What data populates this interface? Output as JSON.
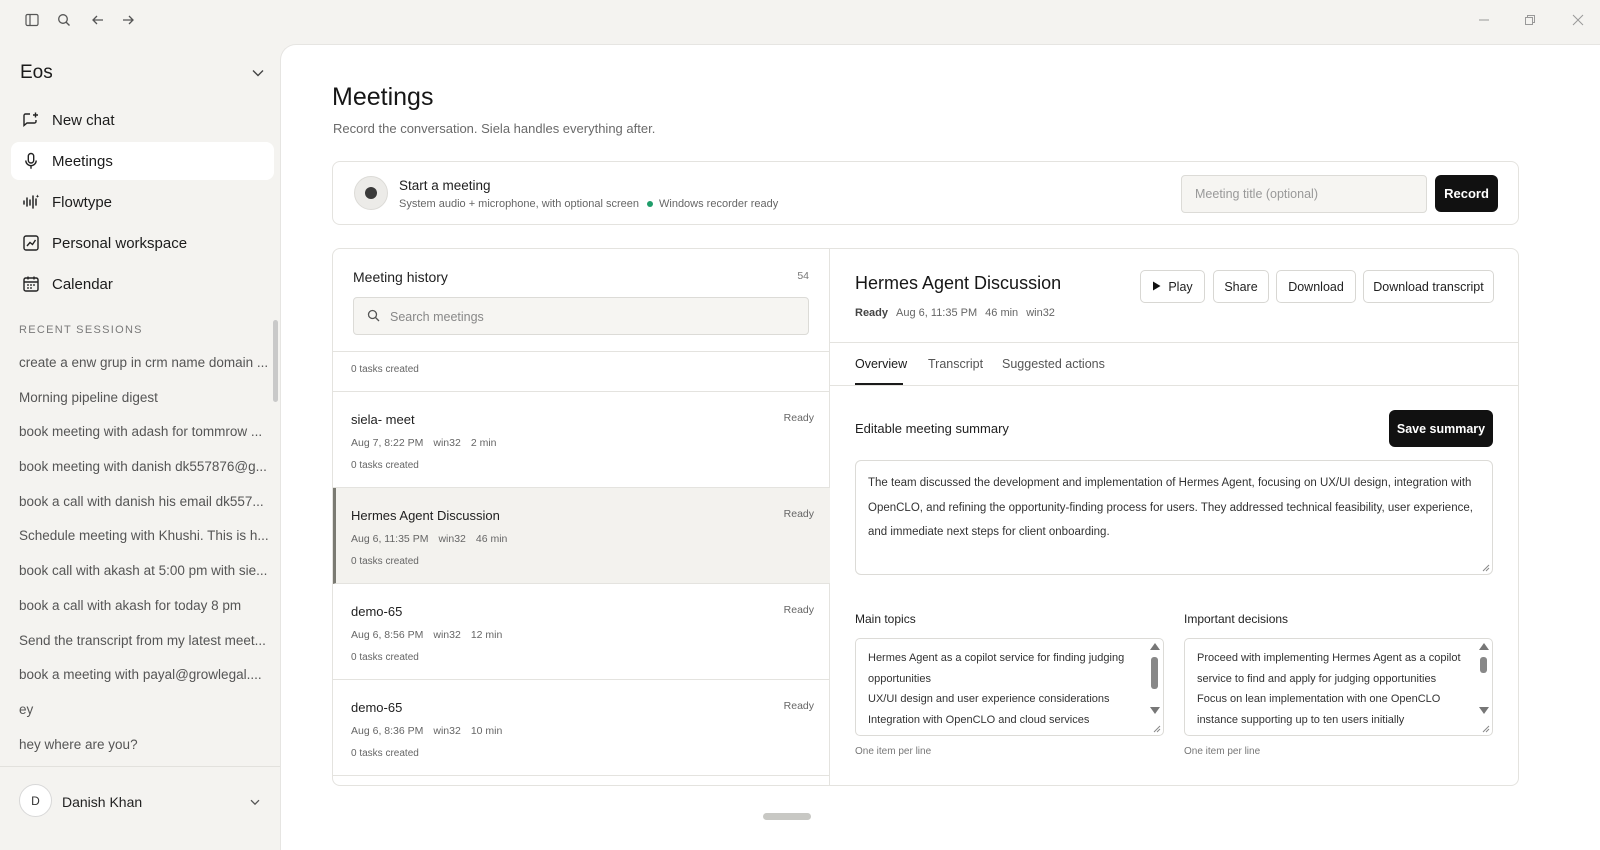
{
  "titlebar": {
    "icons": [
      "sidebar-toggle-icon",
      "search-icon",
      "arrow-left-icon",
      "arrow-right-icon"
    ]
  },
  "sidebar": {
    "workspace": "Eos",
    "nav": [
      {
        "label": "New chat",
        "icon": "new-chat-icon"
      },
      {
        "label": "Meetings",
        "icon": "microphone-icon",
        "active": true
      },
      {
        "label": "Flowtype",
        "icon": "waveform-icon"
      },
      {
        "label": "Personal workspace",
        "icon": "chart-icon"
      },
      {
        "label": "Calendar",
        "icon": "calendar-icon"
      }
    ],
    "recent_heading": "RECENT SESSIONS",
    "recent": [
      "create a enw grup in crm name domain ...",
      "Morning pipeline digest",
      "book meeting with adash for tommrow ...",
      "book meeting with danish dk557876@g...",
      "book a call with danish his email dk557...",
      "Schedule meeting with Khushi. This is h...",
      "book call with akash at 5:00 pm with sie...",
      "book a call with akash for today 8 pm",
      "Send the transcript from my latest meet...",
      "book a meeting with payal@growlegal....",
      "ey",
      "hey where are you?"
    ],
    "user": {
      "initial": "D",
      "name": "Danish Khan"
    }
  },
  "main": {
    "title": "Meetings",
    "subtitle": "Record the conversation. Siela handles everything after.",
    "recorder": {
      "title": "Start a meeting",
      "subtitle": "System audio + microphone, with optional screen",
      "status": "Windows recorder ready",
      "input_placeholder": "Meeting title (optional)",
      "input_value": "",
      "record_label": "Record"
    },
    "history": {
      "title": "Meeting history",
      "count": "54",
      "search_placeholder": "Search meetings",
      "partial_tasks": "0 tasks created",
      "items": [
        {
          "title": "siela- meet",
          "status": "Ready",
          "date": "Aug 7, 8:22 PM",
          "platform": "win32",
          "duration": "2 min",
          "tasks": "0 tasks created"
        },
        {
          "title": "Hermes Agent Discussion",
          "status": "Ready",
          "date": "Aug 6, 11:35 PM",
          "platform": "win32",
          "duration": "46 min",
          "tasks": "0 tasks created"
        },
        {
          "title": "demo-65",
          "status": "Ready",
          "date": "Aug 6, 8:56 PM",
          "platform": "win32",
          "duration": "12 min",
          "tasks": "0 tasks created"
        },
        {
          "title": "demo-65",
          "status": "Ready",
          "date": "Aug 6, 8:36 PM",
          "platform": "win32",
          "duration": "10 min",
          "tasks": "0 tasks created"
        }
      ]
    },
    "detail": {
      "title": "Hermes Agent Discussion",
      "status": "Ready",
      "date": "Aug 6, 11:35 PM",
      "duration": "46 min",
      "platform": "win32",
      "buttons": {
        "play": "Play",
        "share": "Share",
        "download": "Download",
        "download_transcript": "Download transcript"
      },
      "tabs": [
        "Overview",
        "Transcript",
        "Suggested actions"
      ],
      "summary_label": "Editable meeting summary",
      "save_label": "Save summary",
      "summary": "The team discussed the development and implementation of Hermes Agent, focusing on UX/UI design, integration with OpenCLO, and refining the opportunity-finding process for users. They addressed technical feasibility, user experience, and immediate next steps for client onboarding.",
      "main_topics_label": "Main topics",
      "main_topics": [
        "Hermes Agent as a copilot service for finding judging",
        "opportunities",
        "UX/UI design and user experience considerations",
        "Integration with OpenCLO and cloud services"
      ],
      "decisions_label": "Important decisions",
      "decisions": [
        "Proceed with implementing Hermes Agent as a copilot",
        "service to find and apply for judging opportunities",
        "Focus on lean implementation with one OpenCLO",
        "instance supporting up to ten users initially"
      ],
      "hint": "One item per line"
    }
  }
}
